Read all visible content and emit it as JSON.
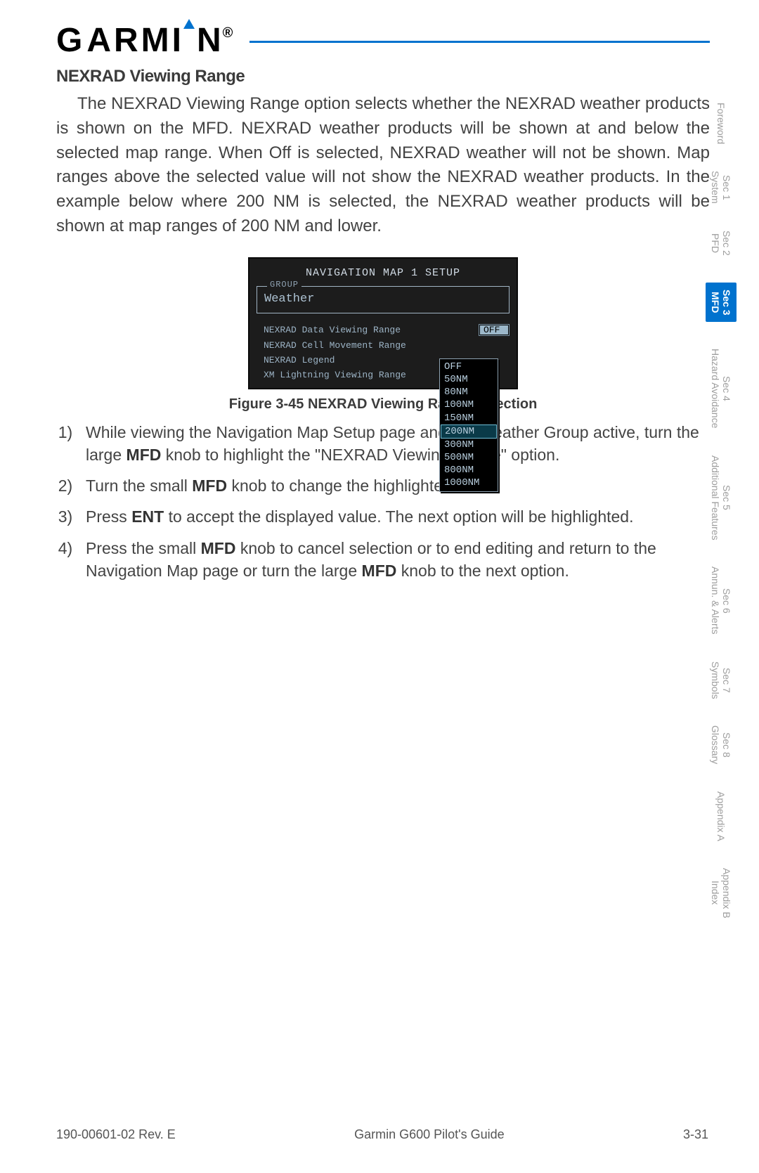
{
  "logo": "GARMIN",
  "section_title": "NEXRAD Viewing Range",
  "body_para": "The NEXRAD Viewing Range option selects whether the NEXRAD weather products is shown on the MFD. NEXRAD weather products will be shown at and below the selected map range. When Off is selected, NEXRAD weather will not be shown. Map ranges above the selected value will not show the NEXRAD weather products. In the example below where 200 NM is selected, the NEXRAD weather products will be shown at map ranges of 200 NM and lower.",
  "lcd": {
    "title": "NAVIGATION MAP 1 SETUP",
    "group_label": "GROUP",
    "group_value": "Weather",
    "options": [
      {
        "label": "NEXRAD Data Viewing Range",
        "value": "OFF",
        "hl": true
      },
      {
        "label": "NEXRAD Cell Movement Range",
        "value": ""
      },
      {
        "label": "NEXRAD Legend",
        "value": ""
      },
      {
        "label": "XM Lightning Viewing Range",
        "value": ""
      }
    ],
    "dropdown": [
      "OFF",
      "50NM",
      "80NM",
      "100NM",
      "150NM",
      "200NM",
      "300NM",
      "500NM",
      "800NM",
      "1000NM"
    ],
    "dropdown_selected": "200NM"
  },
  "figure_caption": "Figure 3-45  NEXRAD Viewing Range Selection",
  "steps": [
    {
      "pre": "While viewing the Navigation Map Setup page and the Weather Group active, turn the large ",
      "b1": "MFD",
      "mid": " knob to highlight the \"NEXRAD Viewing Range\" option."
    },
    {
      "pre": "Turn the small ",
      "b1": "MFD",
      "mid": " knob to change the highlighted value."
    },
    {
      "pre": "Press ",
      "b1": "ENT",
      "mid": " to accept the displayed value. The next option will be highlighted."
    },
    {
      "pre": "Press the small ",
      "b1": "MFD",
      "mid": " knob to cancel selection or to end editing and return to the Navigation Map page or turn the large ",
      "b2": "MFD",
      "post": " knob to the next option."
    }
  ],
  "tabs": [
    {
      "line1": "",
      "line2": "Foreword"
    },
    {
      "line1": "Sec 1",
      "line2": "System"
    },
    {
      "line1": "Sec 2",
      "line2": "PFD"
    },
    {
      "line1": "Sec 3",
      "line2": "MFD",
      "active": true
    },
    {
      "line1": "Sec 4",
      "line2": "Hazard Avoidance"
    },
    {
      "line1": "Sec 5",
      "line2": "Additional Features"
    },
    {
      "line1": "Sec 6",
      "line2": "Annun. & Alerts"
    },
    {
      "line1": "Sec 7",
      "line2": "Symbols"
    },
    {
      "line1": "Sec 8",
      "line2": "Glossary"
    },
    {
      "line1": "",
      "line2": "Appendix A"
    },
    {
      "line1": "Appendix B",
      "line2": "Index"
    }
  ],
  "footer": {
    "left": "190-00601-02  Rev. E",
    "center": "Garmin G600 Pilot's Guide",
    "right": "3-31"
  }
}
